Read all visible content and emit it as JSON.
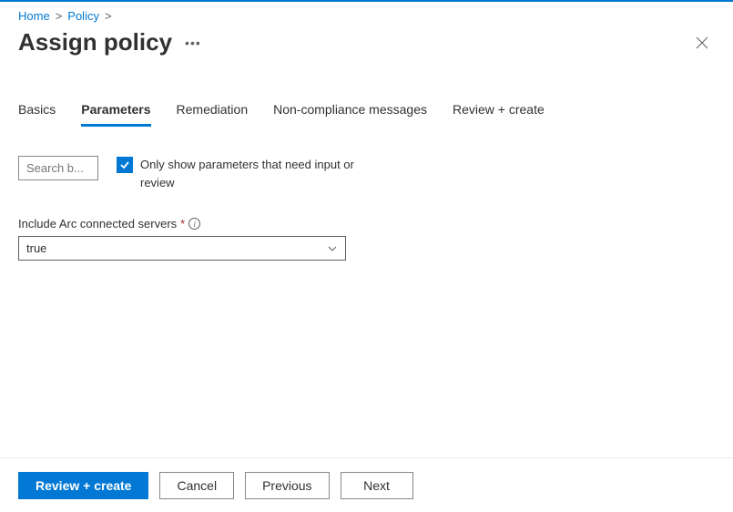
{
  "breadcrumb": {
    "items": [
      {
        "label": "Home"
      },
      {
        "label": "Policy"
      }
    ]
  },
  "header": {
    "title": "Assign policy"
  },
  "tabs": [
    {
      "label": "Basics",
      "active": false
    },
    {
      "label": "Parameters",
      "active": true
    },
    {
      "label": "Remediation",
      "active": false
    },
    {
      "label": "Non-compliance messages",
      "active": false
    },
    {
      "label": "Review + create",
      "active": false
    }
  ],
  "search": {
    "placeholder": "Search b..."
  },
  "filter_checkbox": {
    "checked": true,
    "label": "Only show parameters that need input or review"
  },
  "parameter": {
    "label": "Include Arc connected servers",
    "required_mark": "*",
    "value": "true"
  },
  "footer": {
    "primary": "Review + create",
    "cancel": "Cancel",
    "previous": "Previous",
    "next": "Next"
  }
}
